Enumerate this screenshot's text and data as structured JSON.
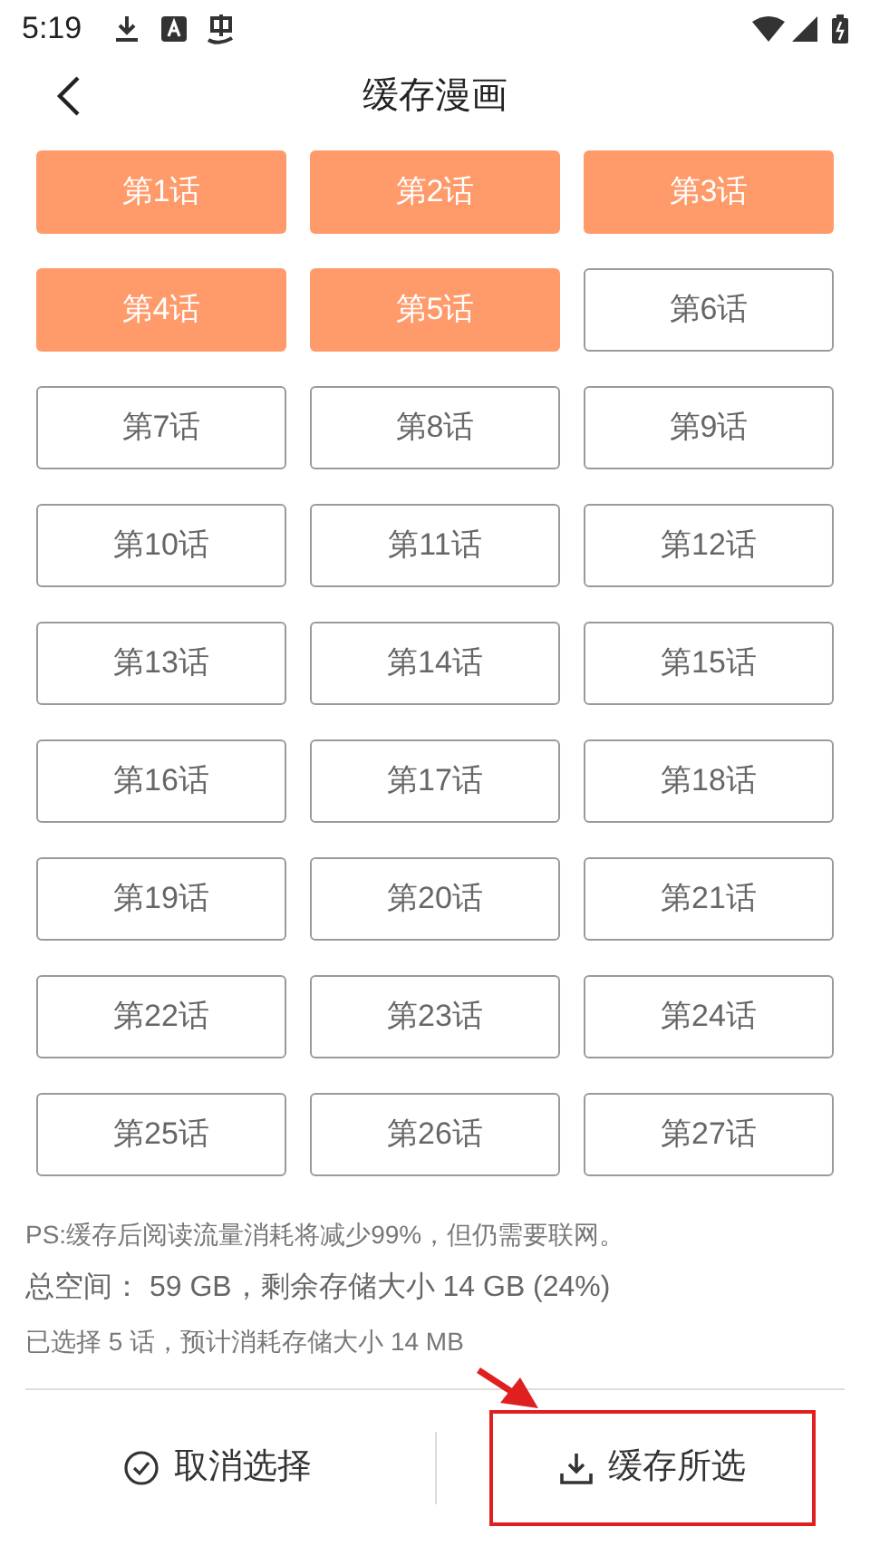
{
  "status_bar": {
    "time": "5:19"
  },
  "header": {
    "title": "缓存漫画"
  },
  "episodes": [
    {
      "label": "第1话",
      "selected": true
    },
    {
      "label": "第2话",
      "selected": true
    },
    {
      "label": "第3话",
      "selected": true
    },
    {
      "label": "第4话",
      "selected": true
    },
    {
      "label": "第5话",
      "selected": true
    },
    {
      "label": "第6话",
      "selected": false
    },
    {
      "label": "第7话",
      "selected": false
    },
    {
      "label": "第8话",
      "selected": false
    },
    {
      "label": "第9话",
      "selected": false
    },
    {
      "label": "第10话",
      "selected": false
    },
    {
      "label": "第11话",
      "selected": false
    },
    {
      "label": "第12话",
      "selected": false
    },
    {
      "label": "第13话",
      "selected": false
    },
    {
      "label": "第14话",
      "selected": false
    },
    {
      "label": "第15话",
      "selected": false
    },
    {
      "label": "第16话",
      "selected": false
    },
    {
      "label": "第17话",
      "selected": false
    },
    {
      "label": "第18话",
      "selected": false
    },
    {
      "label": "第19话",
      "selected": false
    },
    {
      "label": "第20话",
      "selected": false
    },
    {
      "label": "第21话",
      "selected": false
    },
    {
      "label": "第22话",
      "selected": false
    },
    {
      "label": "第23话",
      "selected": false
    },
    {
      "label": "第24话",
      "selected": false
    },
    {
      "label": "第25话",
      "selected": false
    },
    {
      "label": "第26话",
      "selected": false
    },
    {
      "label": "第27话",
      "selected": false
    }
  ],
  "info": {
    "note": "PS:缓存后阅读流量消耗将减少99%，但仍需要联网。",
    "total": "总空间： 59 GB，剩余存储大小 14 GB (24%)",
    "selected_summary": "已选择 5 话，预计消耗存储大小 14 MB"
  },
  "actions": [
    {
      "label": "取消选择",
      "kind": "deselect",
      "highlighted": false
    },
    {
      "label": "缓存所选",
      "kind": "download",
      "highlighted": true
    }
  ]
}
